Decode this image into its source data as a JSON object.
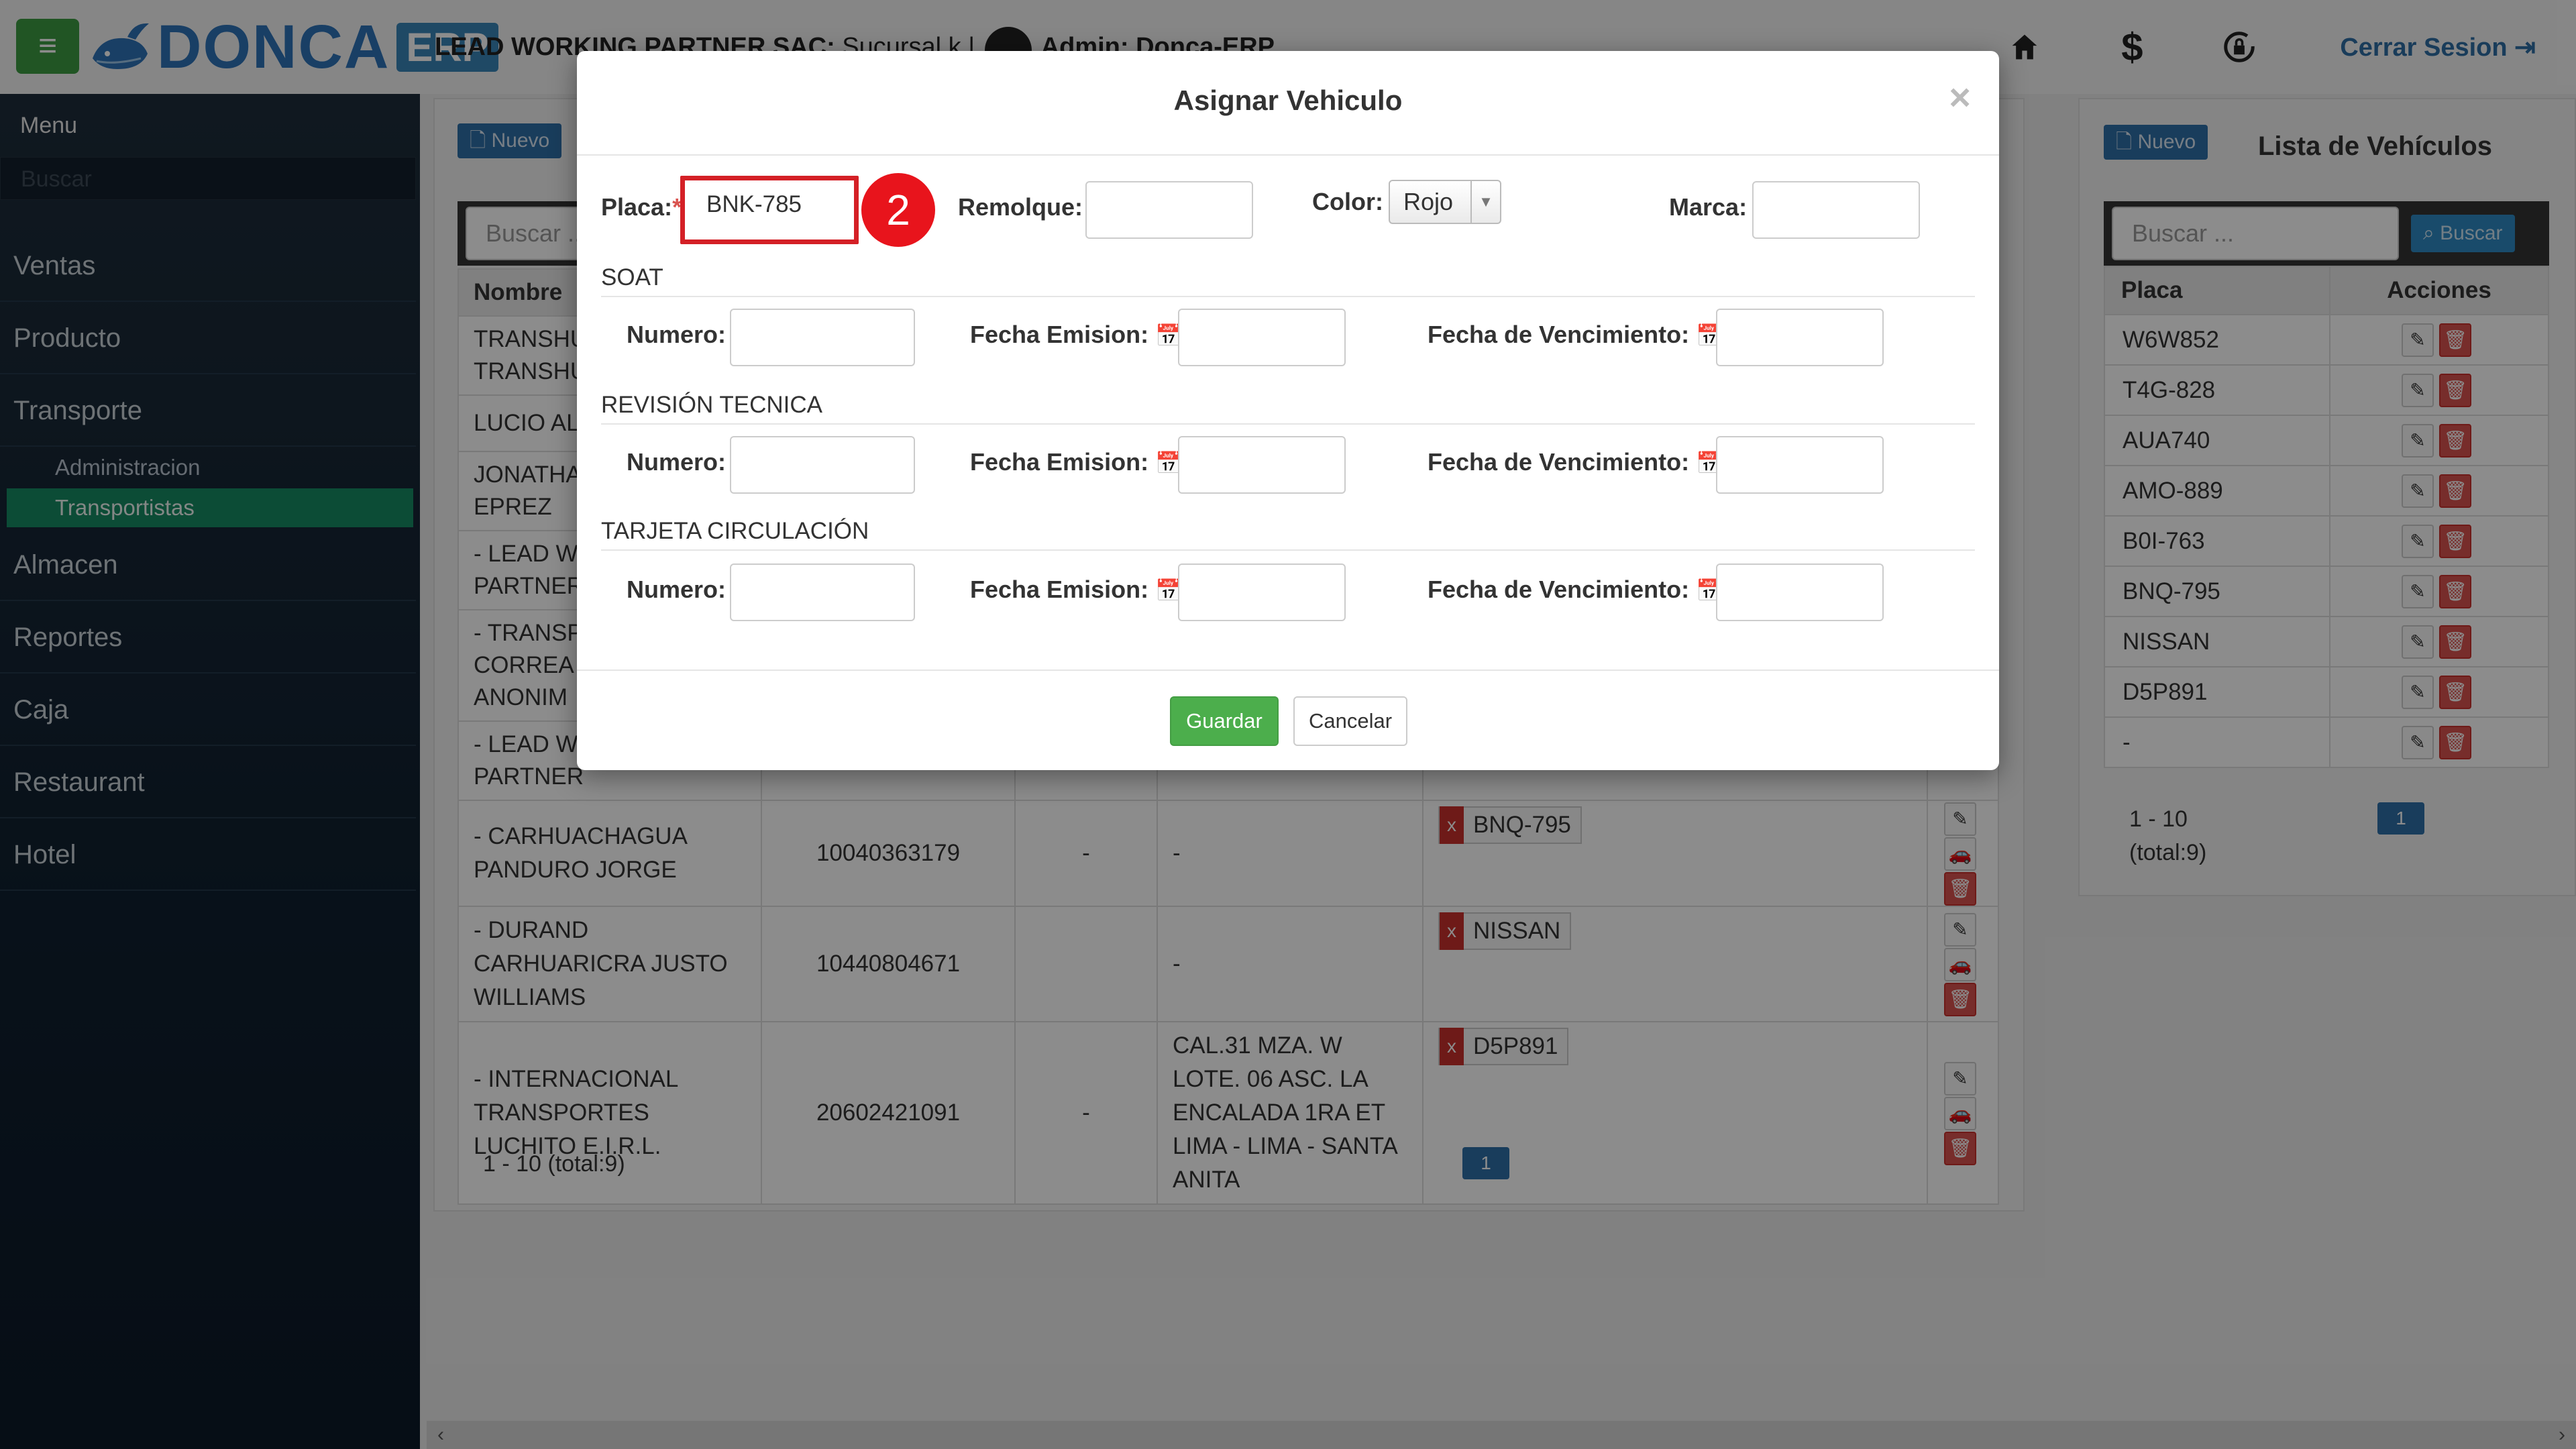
{
  "header": {
    "logo_text": "DONCA",
    "logo_suffix": "ERP",
    "company_name": "LEAD WORKING PARTNER SAC:",
    "branch": " Sucursal k | ",
    "user": "Admin: Donca-ERP",
    "logout_label": "Cerrar Sesion"
  },
  "sidebar": {
    "title": "Menu",
    "search_placeholder": "Buscar",
    "items": [
      "Ventas",
      "Producto",
      "Transporte",
      "Almacen",
      "Reportes",
      "Caja",
      "Restaurant",
      "Hotel"
    ],
    "subitems": [
      "Administracion",
      "Transportistas"
    ],
    "active_subitem": "Transportistas"
  },
  "main": {
    "nuevo_label": "Nuevo",
    "search_placeholder": "Buscar ...",
    "columns": [
      "Nombre"
    ],
    "rows_partial": [
      {
        "name": "TRANSHU\nTRANSHU"
      },
      {
        "name": "LUCIO AL"
      },
      {
        "name": "JONATHA\nEPREZ"
      },
      {
        "name": "- LEAD W\nPARTNER"
      },
      {
        "name": "- TRANSP\nCORREA\nANONIM"
      },
      {
        "name": "- LEAD W\nPARTNER"
      }
    ],
    "rows": [
      {
        "name": "- CARHUACHAGUA PANDURO JORGE",
        "ruc": "10040363179",
        "col3": "-",
        "address": "-",
        "plate": "BNQ-795"
      },
      {
        "name": "- DURAND CARHUARICRA JUSTO WILLIAMS",
        "ruc": "10440804671",
        "col3": "",
        "address": "-",
        "plate": "NISSAN"
      },
      {
        "name": "- INTERNACIONAL TRANSPORTES LUCHITO E.I.R.L.",
        "ruc": "20602421091",
        "col3": "-",
        "address": "CAL.31 MZA. W LOTE. 06 ASC. LA ENCALADA 1RA ET LIMA - LIMA - SANTA ANITA",
        "plate": "D5P891"
      }
    ],
    "plate_remove": "x",
    "pager_text": "1 - 10 (total:9)",
    "pager_page": "1"
  },
  "vehicles_panel": {
    "nuevo_label": "Nuevo",
    "title": "Lista de Vehículos",
    "search_placeholder": "Buscar ...",
    "search_button": "Buscar",
    "columns": [
      "Placa",
      "Acciones"
    ],
    "plates": [
      "W6W852",
      "T4G-828",
      "AUA740",
      "AMO-889",
      "B0I-763",
      "BNQ-795",
      "NISSAN",
      "D5P891",
      "-"
    ],
    "pager_text_1": "1 - 10",
    "pager_text_2": "(total:9)",
    "pager_page": "1"
  },
  "modal": {
    "title": "Asignar Vehiculo",
    "close": "×",
    "placa_label": "Placa:",
    "required_mark": "*",
    "placa_value": "BNK-785",
    "step_badge": "2",
    "remolque_label": "Remolque:",
    "remolque_value": "",
    "color_label": "Color:",
    "color_value": "Rojo",
    "marca_label": "Marca:",
    "marca_value": "",
    "sections": [
      {
        "title": "SOAT",
        "numero_label": "Numero:",
        "emision_label": "Fecha Emision:",
        "venc_label": "Fecha de Vencimiento:"
      },
      {
        "title": "REVISIÓN TECNICA",
        "numero_label": "Numero:",
        "emision_label": "Fecha Emision:",
        "venc_label": "Fecha de Vencimiento:"
      },
      {
        "title": "TARJETA CIRCULACIÓN",
        "numero_label": "Numero:",
        "emision_label": "Fecha Emision:",
        "venc_label": "Fecha de Vencimiento:"
      }
    ],
    "save_label": "Guardar",
    "cancel_label": "Cancelar"
  },
  "icons": {
    "menu": "hamburger-icon",
    "home": "home-icon",
    "dollar": "dollar-icon",
    "settings": "lock-refresh-icon",
    "logout": "sign-out-icon",
    "calendar": "calendar-icon",
    "edit": "pencil-icon",
    "car": "car-icon",
    "delete": "trash-icon",
    "file": "file-icon",
    "search": "search-icon"
  },
  "colors": {
    "sidebar_active": "#168a63",
    "primary": "#2f6fa8",
    "success": "#4cae4c",
    "danger": "#d9534f",
    "highlight": "#d42026"
  }
}
